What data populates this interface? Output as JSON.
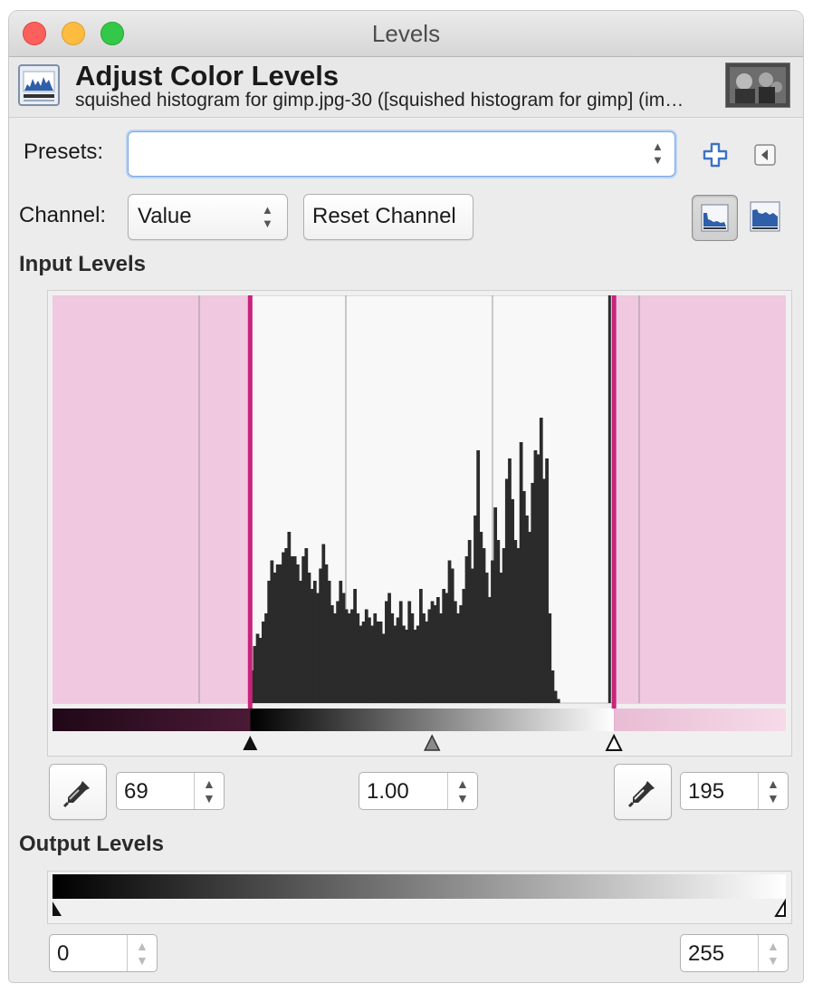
{
  "window": {
    "title": "Levels"
  },
  "header": {
    "title": "Adjust Color Levels",
    "subtitle": "squished histogram for gimp.jpg-30 ([squished histogram for gimp] (im…"
  },
  "presets": {
    "label": "Presets:",
    "value": ""
  },
  "channel": {
    "label": "Channel:",
    "value": "Value",
    "reset_label": "Reset Channel"
  },
  "input_levels": {
    "title": "Input Levels",
    "low": "69",
    "gamma": "1.00",
    "high": "195",
    "low_value": 69,
    "gamma_value": 1.0,
    "high_value": 195,
    "clip_color": "#f0c8e0",
    "marker_color": "#c8247a"
  },
  "output_levels": {
    "title": "Output Levels",
    "low": "0",
    "high": "255"
  },
  "icons": {
    "add": "plus-icon",
    "menu": "triangle-left-icon",
    "linear_histogram": "linear-histogram-icon",
    "log_histogram": "log-histogram-icon",
    "picker": "eyedropper-icon"
  },
  "chart_data": {
    "type": "bar",
    "xlim": [
      0,
      255
    ],
    "x": [
      69,
      70,
      71,
      72,
      73,
      74,
      75,
      76,
      77,
      78,
      79,
      80,
      81,
      82,
      83,
      84,
      85,
      86,
      87,
      88,
      89,
      90,
      91,
      92,
      93,
      94,
      95,
      96,
      97,
      98,
      99,
      100,
      101,
      102,
      103,
      104,
      105,
      106,
      107,
      108,
      109,
      110,
      111,
      112,
      113,
      114,
      115,
      116,
      117,
      118,
      119,
      120,
      121,
      122,
      123,
      124,
      125,
      126,
      127,
      128,
      129,
      130,
      131,
      132,
      133,
      134,
      135,
      136,
      137,
      138,
      139,
      140,
      141,
      142,
      143,
      144,
      145,
      146,
      147,
      148,
      149,
      150,
      151,
      152,
      153,
      154,
      155,
      156,
      157,
      158,
      159,
      160,
      161,
      162,
      163,
      164,
      165,
      166,
      167,
      168,
      169,
      170,
      171,
      172,
      173,
      174,
      175,
      176,
      177,
      178,
      179,
      180,
      181,
      182,
      183,
      184,
      185,
      186,
      187,
      188,
      189,
      190,
      191,
      192,
      193,
      194,
      195
    ],
    "values": [
      8,
      14,
      17,
      16,
      20,
      22,
      30,
      35,
      32,
      34,
      34,
      37,
      38,
      42,
      36,
      36,
      34,
      30,
      36,
      38,
      32,
      28,
      30,
      27,
      33,
      39,
      34,
      30,
      24,
      22,
      25,
      30,
      27,
      23,
      22,
      23,
      28,
      22,
      19,
      20,
      23,
      21,
      19,
      22,
      20,
      20,
      17,
      25,
      27,
      22,
      19,
      21,
      25,
      19,
      18,
      25,
      22,
      18,
      19,
      28,
      22,
      20,
      23,
      25,
      24,
      26,
      22,
      28,
      27,
      35,
      33,
      25,
      22,
      24,
      28,
      36,
      40,
      33,
      46,
      62,
      42,
      38,
      32,
      26,
      35,
      48,
      40,
      32,
      38,
      55,
      60,
      50,
      40,
      38,
      64,
      52,
      46,
      42,
      54,
      62,
      61,
      70,
      55,
      60,
      22,
      8,
      3,
      1
    ],
    "peak_x": 194,
    "ylim": [
      0,
      100
    ]
  }
}
